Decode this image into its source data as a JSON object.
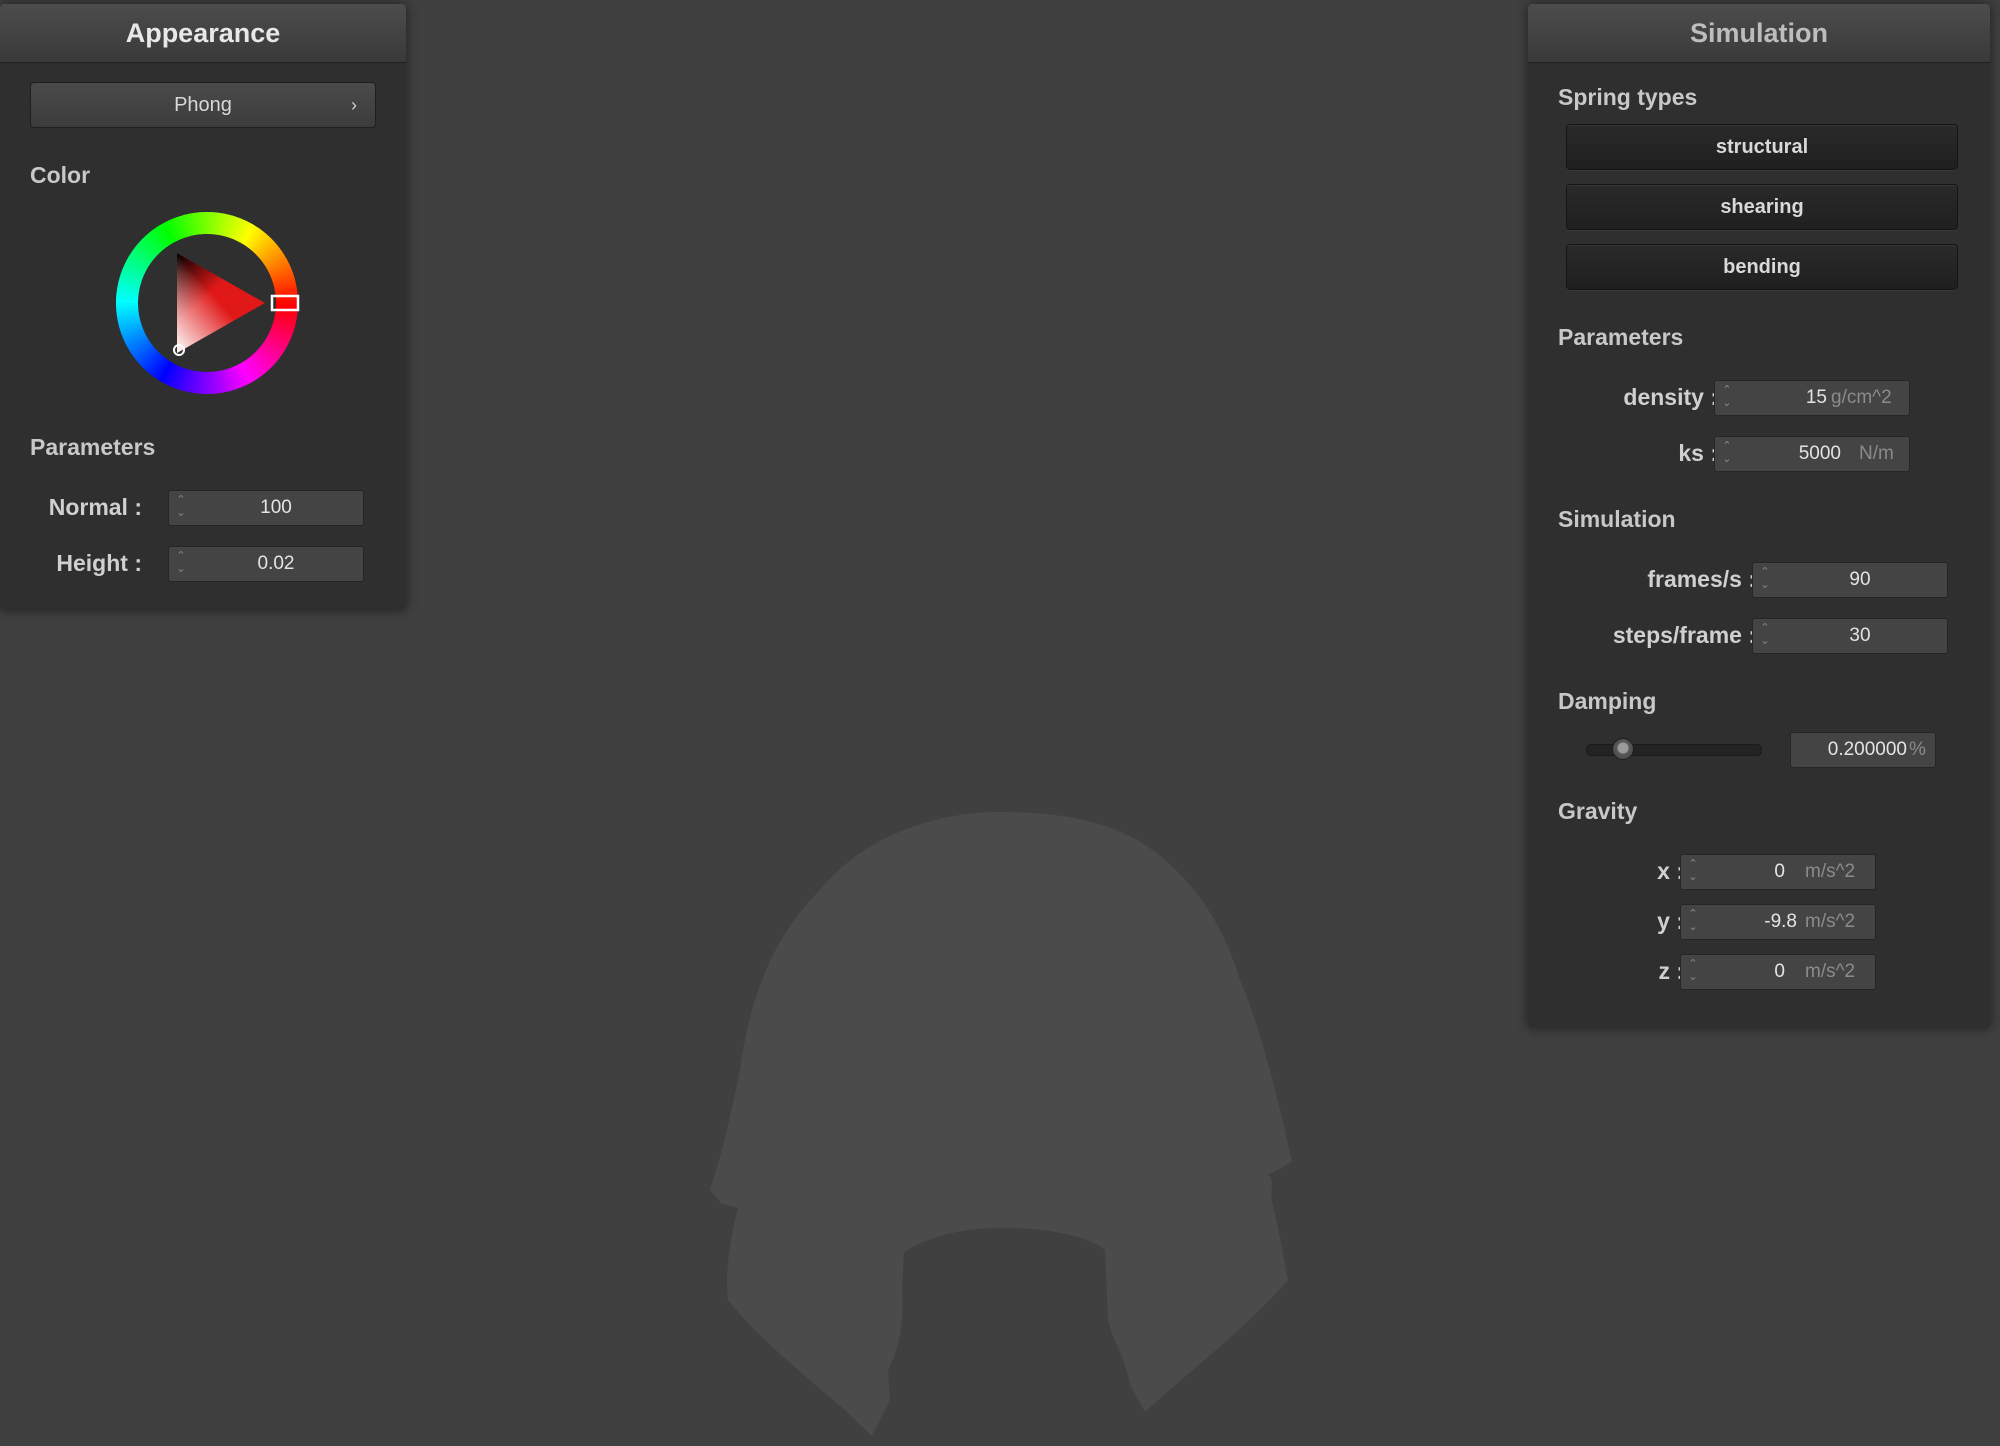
{
  "appearance": {
    "title": "Appearance",
    "shader": {
      "selected": "Phong"
    },
    "color_label": "Color",
    "color": "#e01818",
    "parameters_label": "Parameters",
    "normal": {
      "label": "Normal :",
      "value": "100"
    },
    "height": {
      "label": "Height :",
      "value": "0.02"
    }
  },
  "simulation": {
    "title": "Simulation",
    "spring_types_label": "Spring types",
    "springs": [
      "structural",
      "shearing",
      "bending"
    ],
    "parameters_label": "Parameters",
    "density": {
      "label": "density :",
      "value": "15",
      "unit": "g/cm^2"
    },
    "ks": {
      "label": "ks :",
      "value": "5000",
      "unit": "N/m"
    },
    "simulation_label": "Simulation",
    "frames_per_s": {
      "label": "frames/s :",
      "value": "90"
    },
    "steps_per_frame": {
      "label": "steps/frame :",
      "value": "30"
    },
    "damping_label": "Damping",
    "damping": {
      "value": "0.200000",
      "unit": "%",
      "slider_fraction": 0.2
    },
    "gravity_label": "Gravity",
    "gravity": {
      "x": {
        "label": "x :",
        "value": "0",
        "unit": "m/s^2"
      },
      "y": {
        "label": "y :",
        "value": "-9.8",
        "unit": "m/s^2"
      },
      "z": {
        "label": "z :",
        "value": "0",
        "unit": "m/s^2"
      }
    }
  },
  "scene": {
    "background": "#404040",
    "cloth_color": "#4b4b4b"
  }
}
